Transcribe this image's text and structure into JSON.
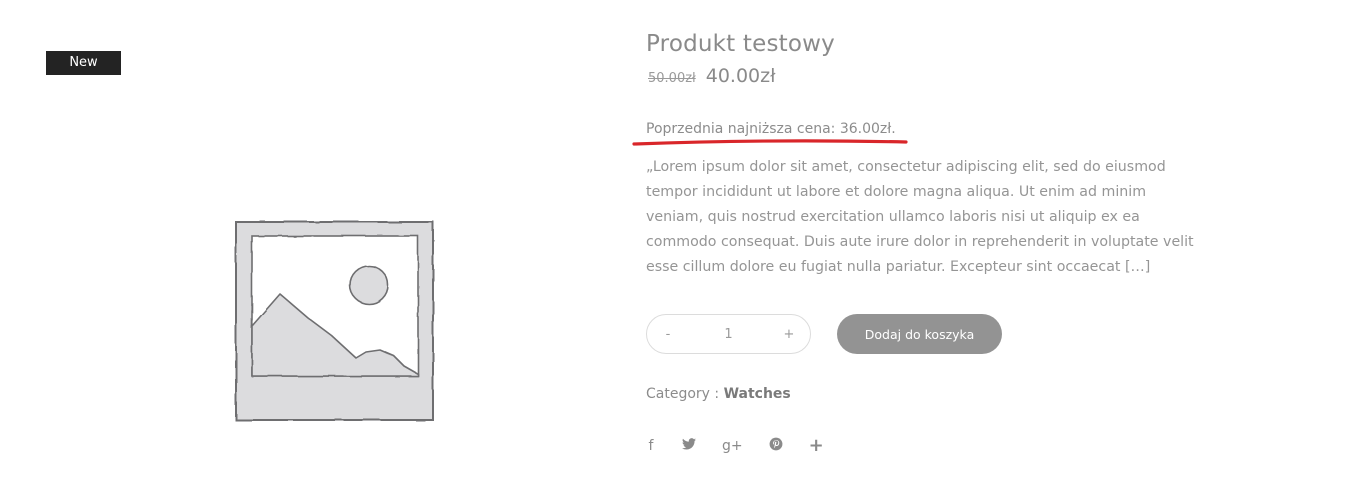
{
  "gallery": {
    "badge_label": "New",
    "image_icon": "image-placeholder-icon"
  },
  "product": {
    "title": "Produkt testowy",
    "old_price": "50.00zł",
    "price": "40.00zł",
    "lowest_price_note": "Poprzednia najniższa cena: 36.00zł.",
    "description": "„Lorem ipsum dolor sit amet, consectetur adipiscing elit, sed do eiusmod tempor incididunt ut labore et dolore magna aliqua. Ut enim ad minim veniam, quis nostrud exercitation ullamco laboris nisi ut aliquip ex ea commodo consequat. Duis aute irure dolor in reprehenderit in voluptate velit esse cillum dolore eu fugiat nulla pariatur. Excepteur sint occaecat […]"
  },
  "cart": {
    "minus_label": "-",
    "quantity": "1",
    "plus_label": "+",
    "add_label": "Dodaj do koszyka"
  },
  "meta": {
    "category_label": "Category : ",
    "category_value": "Watches"
  },
  "share": {
    "icons": [
      "facebook-icon",
      "twitter-icon",
      "google-plus-icon",
      "pinterest-icon",
      "plus-icon"
    ],
    "facebook": "f",
    "google_plus": "g+",
    "plus": "+"
  },
  "colors": {
    "badge_bg": "#232323",
    "button_bg": "#939393",
    "highlight_underline": "#d9262a",
    "text": "#8c8c8c"
  }
}
